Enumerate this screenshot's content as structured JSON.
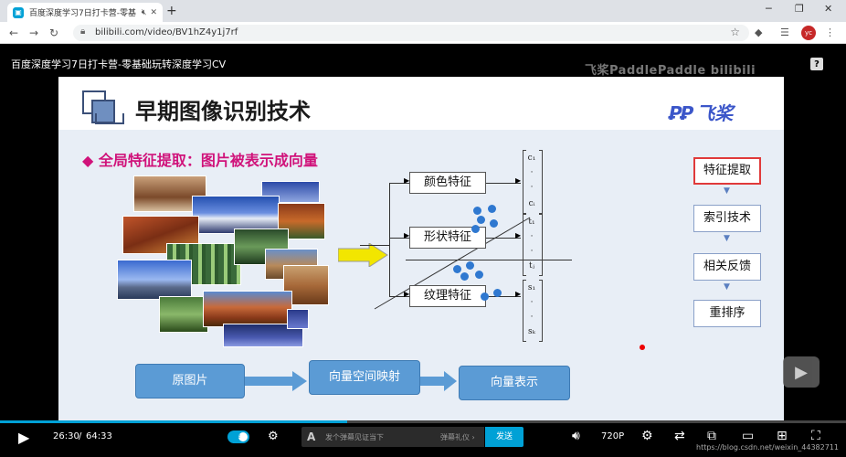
{
  "browser": {
    "tab_title": "百度深度学习7日打卡营-零基",
    "url": "bilibili.com/video/BV1hZ4y1j7rf",
    "avatar": "yc"
  },
  "video": {
    "title": "百度深度学习7日打卡营-零基础玩转深度学习CV",
    "watermark": "飞桨PaddlePaddle bilibili"
  },
  "slide": {
    "title": "早期图像识别技术",
    "logo": "飞桨",
    "bullet": "◆ 全局特征提取：图片被表示成向量",
    "features": [
      "颜色特征",
      "形状特征",
      "纹理特征"
    ],
    "vectors": [
      {
        "top": "c₁",
        "mid": "·",
        "bot": "cᵢ"
      },
      {
        "top": "t₁",
        "mid": "·",
        "bot": "tⱼ"
      },
      {
        "top": "s₁",
        "mid": "·",
        "bot": "sₖ"
      }
    ],
    "flow": [
      "特征提取",
      "索引技术",
      "相关反馈",
      "重排序"
    ],
    "bottom_boxes": [
      "原图片",
      "向量空间映射",
      "向量表示"
    ]
  },
  "player": {
    "time_current": "26:30",
    "time_sep": "/",
    "time_total": "64:33",
    "progress": 0.41,
    "danmu_toggle_label": "弹",
    "danmu_placeholder": "发个弹幕见证当下",
    "danmu_etiquette": "弹幕礼仪 ›",
    "send_label": "发送",
    "quality": "720P"
  },
  "footer_watermark": "https://blog.csdn.net/weixin_44382711"
}
